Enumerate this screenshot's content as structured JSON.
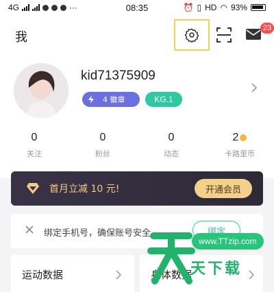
{
  "status_bar": {
    "network": "4G",
    "time": "08:35",
    "hd": "HD",
    "battery": "93%"
  },
  "header": {
    "title": "我",
    "settings_icon": "gear-icon",
    "scan_icon": "scan-icon",
    "mail_icon": "mail-icon",
    "mail_badge": "23"
  },
  "profile": {
    "username": "kid71375909",
    "badge_count_label": "4 徽章",
    "level_label": "KG.1"
  },
  "stats": [
    {
      "value": "0",
      "label": "关注"
    },
    {
      "value": "0",
      "label": "粉丝"
    },
    {
      "value": "0",
      "label": "动态"
    },
    {
      "value": "2",
      "label": "卡路里币"
    }
  ],
  "vip": {
    "text": "首月立减 10 元!",
    "button": "开通会员"
  },
  "bind_phone": {
    "text": "绑定手机号，确保账号安全",
    "button": "绑定"
  },
  "cards": {
    "left_title": "运动数据",
    "right_title": "身体数据"
  },
  "watermark": {
    "url": "www.TTzip.com",
    "name": "天下载"
  },
  "colors": {
    "accent_green": "#2fc8a0",
    "vip_gold": "#f4d188",
    "badge_red": "#ff4d4f",
    "chip_purple": "#6c6fe0"
  }
}
